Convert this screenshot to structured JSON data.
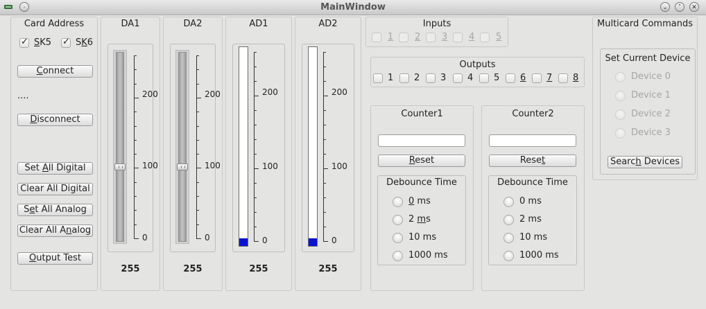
{
  "window": {
    "title": "MainWindow"
  },
  "card_address": {
    "heading": "Card Address",
    "sk5_label": "SK5",
    "sk5_checked": true,
    "sk6_label": "SK6",
    "sk6_checked": true
  },
  "left_buttons": {
    "connect": "Connect",
    "status": "....",
    "disconnect": "Disconnect",
    "set_all_digital": "Set All Digital",
    "clear_all_digital": "Clear All Digital",
    "set_all_analog": "Set All Analog",
    "clear_all_analog": "Clear All Analog",
    "output_test": "Output Test"
  },
  "channels": [
    {
      "name": "DA1",
      "kind": "slider",
      "value": "255",
      "level": 0.4,
      "ticks": [
        "200",
        "100",
        "0"
      ]
    },
    {
      "name": "DA2",
      "kind": "slider",
      "value": "255",
      "level": 0.4,
      "ticks": [
        "200",
        "100",
        "0"
      ]
    },
    {
      "name": "AD1",
      "kind": "bar",
      "value": "255",
      "level": 0.04,
      "ticks": [
        "200",
        "100",
        "0"
      ]
    },
    {
      "name": "AD2",
      "kind": "bar",
      "value": "255",
      "level": 0.04,
      "ticks": [
        "200",
        "100",
        "0"
      ]
    }
  ],
  "inputs": {
    "heading": "Inputs",
    "items": [
      "1",
      "2",
      "3",
      "4",
      "5"
    ]
  },
  "outputs": {
    "heading": "Outputs",
    "items": [
      "1",
      "2",
      "3",
      "4",
      "5",
      "6",
      "7",
      "8"
    ]
  },
  "counters": [
    {
      "title": "Counter1",
      "value": "",
      "reset": "Reset",
      "debounce_title": "Debounce Time",
      "options": [
        "0 ms",
        "2 ms",
        "10 ms",
        "1000 ms"
      ]
    },
    {
      "title": "Counter2",
      "value": "",
      "reset": "Reset",
      "debounce_title": "Debounce Time",
      "options": [
        "0 ms",
        "2 ms",
        "10 ms",
        "1000 ms"
      ]
    }
  ],
  "multicard": {
    "heading": "Multicard Commands",
    "set_device_title": "Set Current Device",
    "devices": [
      "Device 0",
      "Device 1",
      "Device 2",
      "Device 3"
    ],
    "search": "Search Devices"
  }
}
